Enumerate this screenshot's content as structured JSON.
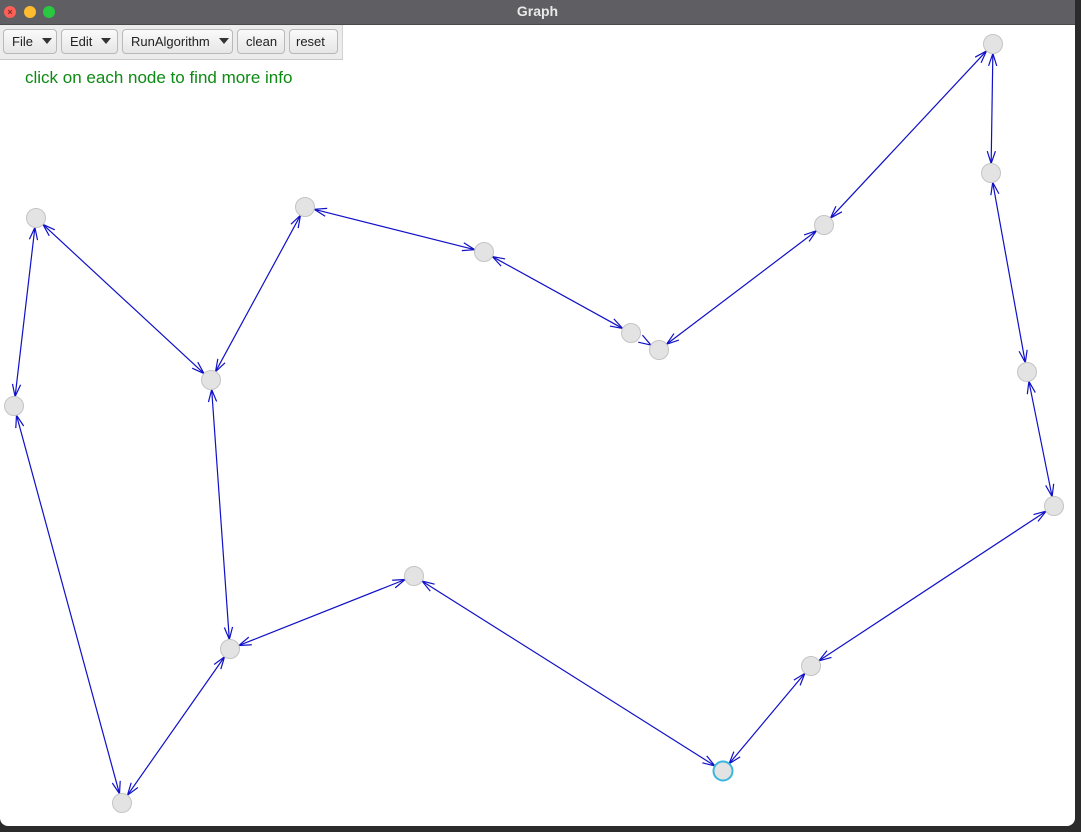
{
  "window": {
    "title": "Graph"
  },
  "menubar": {
    "file": "File",
    "edit": "Edit",
    "run": "RunAlgorithm",
    "clean": "clean",
    "reset": "reset"
  },
  "hint": "click on each node to find more info",
  "colors": {
    "edge": "#1010c8",
    "node_fill": "#e3e3e3",
    "node_stroke": "#c4c4c4",
    "selected_stroke": "#3bb6df",
    "hint": "#0d8a14"
  },
  "graph": {
    "selected_node": "n14",
    "nodes": [
      {
        "id": "n0"
      },
      {
        "id": "n1"
      },
      {
        "id": "n2"
      },
      {
        "id": "n3"
      },
      {
        "id": "n4"
      },
      {
        "id": "n5"
      },
      {
        "id": "n6"
      },
      {
        "id": "n7"
      },
      {
        "id": "n8"
      },
      {
        "id": "n9"
      },
      {
        "id": "n10"
      },
      {
        "id": "n11"
      },
      {
        "id": "n12"
      },
      {
        "id": "n13"
      },
      {
        "id": "n14"
      },
      {
        "id": "n15"
      },
      {
        "id": "n16"
      },
      {
        "id": "n17"
      },
      {
        "id": "n18"
      }
    ],
    "edges": [
      [
        "n0",
        "n1"
      ],
      [
        "n0",
        "n2"
      ],
      [
        "n2",
        "n3"
      ],
      [
        "n3",
        "n4"
      ],
      [
        "n4",
        "n5"
      ],
      [
        "n5",
        "n6"
      ],
      [
        "n6",
        "n7"
      ],
      [
        "n7",
        "n8"
      ],
      [
        "n8",
        "n9"
      ],
      [
        "n9",
        "n10"
      ],
      [
        "n10",
        "n11"
      ],
      [
        "n11",
        "n12"
      ],
      [
        "n12",
        "n13"
      ],
      [
        "n13",
        "n14"
      ],
      [
        "n14",
        "n15"
      ],
      [
        "n15",
        "n16"
      ],
      [
        "n16",
        "n17"
      ],
      [
        "n17",
        "n18"
      ],
      [
        "n18",
        "n1"
      ]
    ]
  }
}
